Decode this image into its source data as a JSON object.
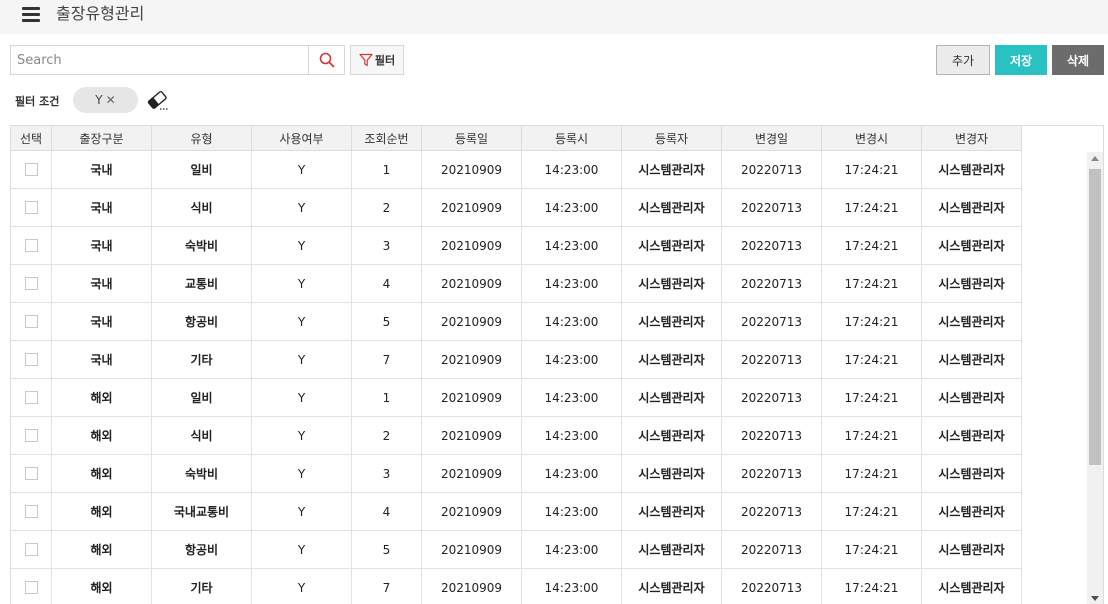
{
  "header": {
    "title": "출장유형관리"
  },
  "search": {
    "placeholder": "Search"
  },
  "toolbar": {
    "filter_label": "필터",
    "add_label": "추가",
    "save_label": "저장",
    "delete_label": "삭제"
  },
  "filter": {
    "label": "필터 조건",
    "chips": [
      {
        "value": "Y"
      }
    ]
  },
  "icons": {
    "menu": "hamburger-icon",
    "search": "search-icon",
    "filter": "funnel-icon",
    "chip_close": "close-icon",
    "clear_filters": "eraser-icon"
  },
  "colors": {
    "save": "#28c2c2",
    "delete": "#6c6c6c",
    "search_icon": "#d03838",
    "filter_icon": "#d03838"
  },
  "table": {
    "columns": [
      "선택",
      "출장구분",
      "유형",
      "사용여부",
      "조회순번",
      "등록일",
      "등록시",
      "등록자",
      "변경일",
      "변경시",
      "변경자"
    ],
    "rows": [
      [
        "국내",
        "일비",
        "Y",
        "1",
        "20210909",
        "14:23:00",
        "시스템관리자",
        "20220713",
        "17:24:21",
        "시스템관리자"
      ],
      [
        "국내",
        "식비",
        "Y",
        "2",
        "20210909",
        "14:23:00",
        "시스템관리자",
        "20220713",
        "17:24:21",
        "시스템관리자"
      ],
      [
        "국내",
        "숙박비",
        "Y",
        "3",
        "20210909",
        "14:23:00",
        "시스템관리자",
        "20220713",
        "17:24:21",
        "시스템관리자"
      ],
      [
        "국내",
        "교통비",
        "Y",
        "4",
        "20210909",
        "14:23:00",
        "시스템관리자",
        "20220713",
        "17:24:21",
        "시스템관리자"
      ],
      [
        "국내",
        "항공비",
        "Y",
        "5",
        "20210909",
        "14:23:00",
        "시스템관리자",
        "20220713",
        "17:24:21",
        "시스템관리자"
      ],
      [
        "국내",
        "기타",
        "Y",
        "7",
        "20210909",
        "14:23:00",
        "시스템관리자",
        "20220713",
        "17:24:21",
        "시스템관리자"
      ],
      [
        "해외",
        "일비",
        "Y",
        "1",
        "20210909",
        "14:23:00",
        "시스템관리자",
        "20220713",
        "17:24:21",
        "시스템관리자"
      ],
      [
        "해외",
        "식비",
        "Y",
        "2",
        "20210909",
        "14:23:00",
        "시스템관리자",
        "20220713",
        "17:24:21",
        "시스템관리자"
      ],
      [
        "해외",
        "숙박비",
        "Y",
        "3",
        "20210909",
        "14:23:00",
        "시스템관리자",
        "20220713",
        "17:24:21",
        "시스템관리자"
      ],
      [
        "해외",
        "국내교통비",
        "Y",
        "4",
        "20210909",
        "14:23:00",
        "시스템관리자",
        "20220713",
        "17:24:21",
        "시스템관리자"
      ],
      [
        "해외",
        "항공비",
        "Y",
        "5",
        "20210909",
        "14:23:00",
        "시스템관리자",
        "20220713",
        "17:24:21",
        "시스템관리자"
      ],
      [
        "해외",
        "기타",
        "Y",
        "7",
        "20210909",
        "14:23:00",
        "시스템관리자",
        "20220713",
        "17:24:21",
        "시스템관리자"
      ]
    ]
  }
}
